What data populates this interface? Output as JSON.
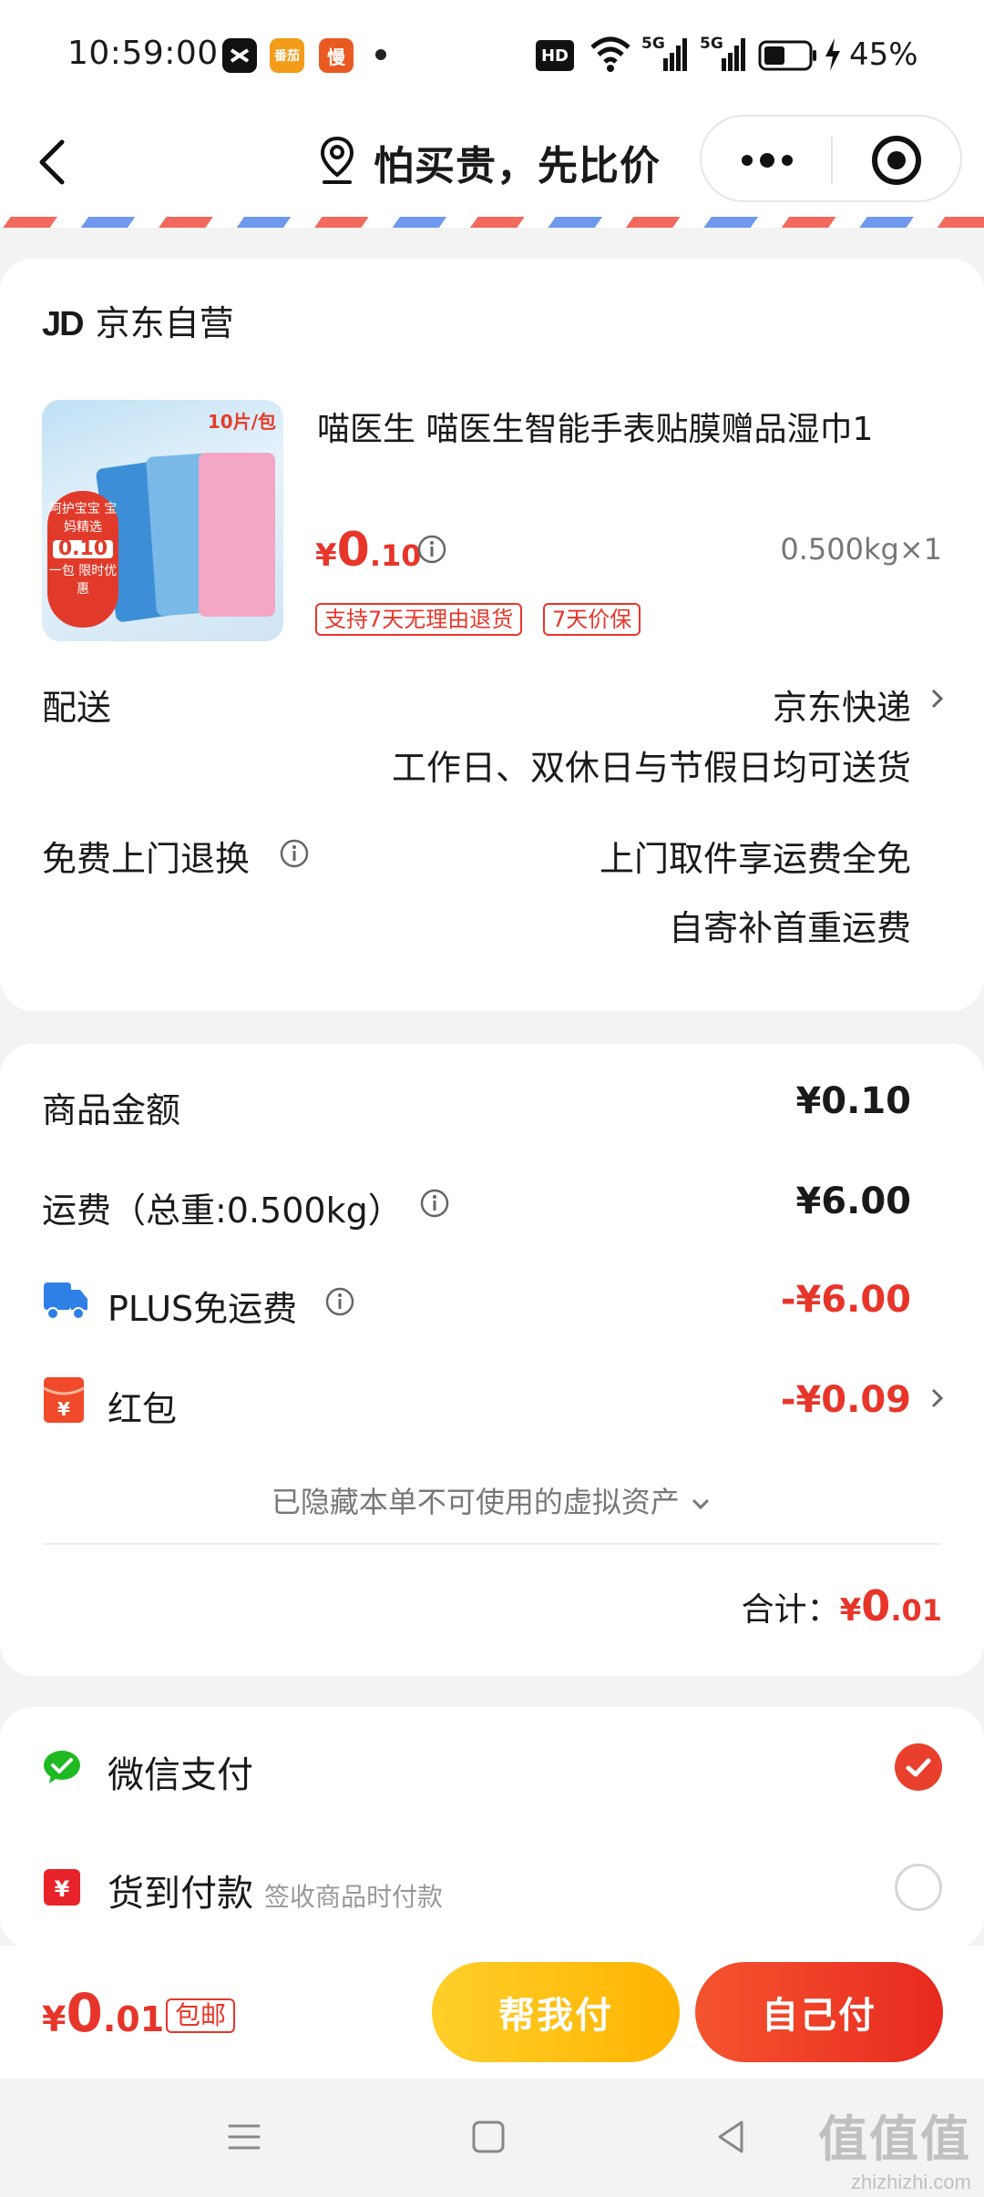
{
  "status_bar": {
    "time": "10:59:00",
    "apps": [
      "capcut-icon",
      "fanqie-icon",
      "man-icon"
    ],
    "app_labels": [
      "",
      "番茄",
      "慢"
    ],
    "network": "HD",
    "signal1": "5G",
    "signal2": "5G",
    "battery": "45%"
  },
  "header": {
    "title": "怕买贵，先比价"
  },
  "shop": {
    "logo": "JD",
    "name": "京东自营"
  },
  "product": {
    "title": "喵医生 喵医生智能手表贴膜赠品湿巾1",
    "thumb_badge": "10片/包",
    "thumb_promo": "呵护宝宝 宝妈精选",
    "thumb_price": "0.10",
    "thumb_note": "一包 限时优惠",
    "price_yen": "¥",
    "price_int": "0",
    "price_dec": ".10",
    "weight": "0.500kg×1",
    "tags": [
      "支持7天无理由退货",
      "7天价保"
    ]
  },
  "delivery": {
    "label": "配送",
    "carrier": "京东快递",
    "schedule": "工作日、双休日与节假日均可送货"
  },
  "return_service": {
    "label": "免费上门退换",
    "line1": "上门取件享运费全免",
    "line2": "自寄补首重运费"
  },
  "fees": {
    "goods_label": "商品金额",
    "goods_value": "¥0.10",
    "shipping_label": "运费（总重:0.500kg）",
    "shipping_value": "¥6.00",
    "plus_label": "PLUS免运费",
    "plus_value": "-¥6.00",
    "redpack_label": "红包",
    "redpack_value": "-¥0.09",
    "hidden_assets": "已隐藏本单不可使用的虚拟资产",
    "total_label": "合计：",
    "total_yen": "¥",
    "total_int": "0",
    "total_dec": ".01"
  },
  "payment": {
    "wechat_label": "微信支付",
    "cod_label": "货到付款",
    "cod_sub": "签收商品时付款",
    "selected": "wechat"
  },
  "bottom_bar": {
    "price_yen": "¥",
    "price_int": "0",
    "price_dec": ".01",
    "free_shipping": "包邮",
    "help_pay": "帮我付",
    "self_pay": "自己付"
  },
  "watermark": {
    "brand": "值值值",
    "url": "zhizhizhi.com"
  },
  "colors": {
    "accent_red": "#e8352a",
    "help_yellow": "#ffc21a",
    "wechat_green": "#1fb922"
  }
}
